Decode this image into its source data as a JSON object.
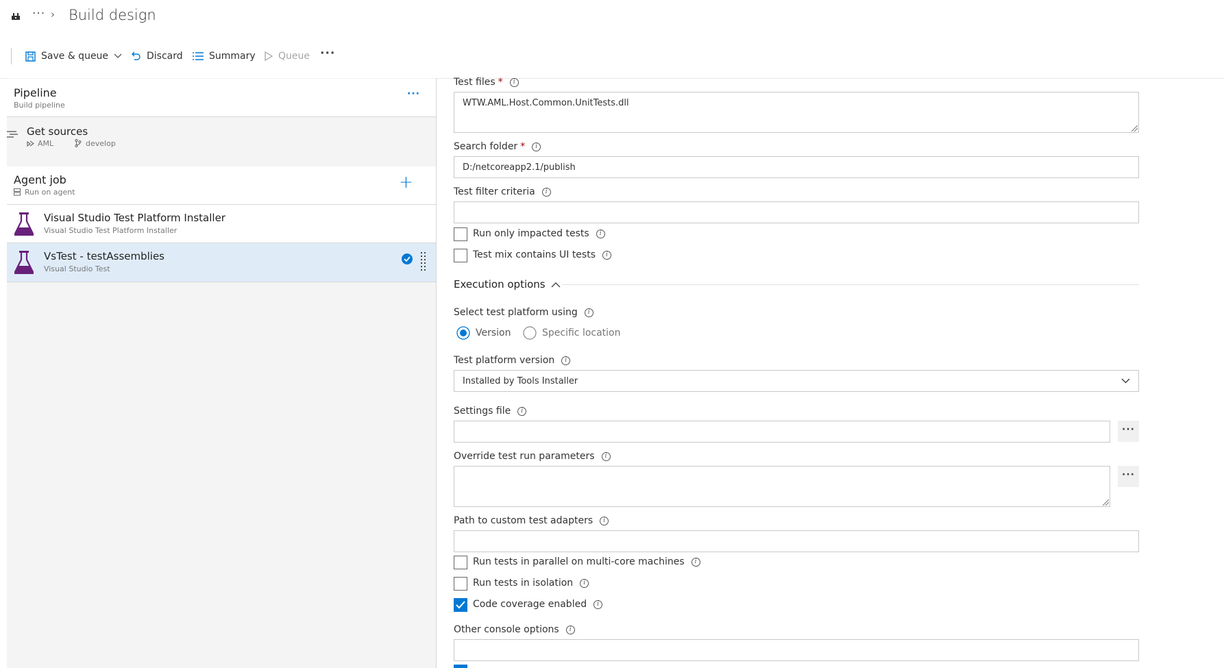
{
  "header": {
    "title": "Build design",
    "breadcrumb_more": "···",
    "breadcrumb_chevron": "›"
  },
  "toolbar": {
    "save_queue": "Save & queue",
    "discard": "Discard",
    "summary": "Summary",
    "queue": "Queue",
    "more": "···"
  },
  "pipeline": {
    "title": "Pipeline",
    "subtitle": "Build pipeline",
    "more": "···",
    "get_sources": "Get sources",
    "repo": "AML",
    "branch": "develop",
    "agent_job": "Agent job",
    "agent_sub": "Run on agent",
    "add": "+",
    "tasks": [
      {
        "title": "Visual Studio Test Platform Installer",
        "subtitle": "Visual Studio Test Platform Installer"
      },
      {
        "title": "VsTest - testAssemblies",
        "subtitle": "Visual Studio Test"
      }
    ]
  },
  "form": {
    "test_files_label": "Test files",
    "test_files_value": "WTW.AML.Host.Common.UnitTests.dll",
    "search_folder_label": "Search folder",
    "search_folder_value": "D:/netcoreapp2.1/publish",
    "required_mark": "*",
    "test_filter_label": "Test filter criteria",
    "run_impacted_label": "Run only impacted tests",
    "ui_tests_label": "Test mix contains UI tests",
    "execution_options": "Execution options",
    "select_platform_label": "Select test platform using",
    "radio_version": "Version",
    "radio_specific": "Specific location",
    "platform_version_label": "Test platform version",
    "platform_version_value": "Installed by Tools Installer",
    "settings_file_label": "Settings file",
    "override_label": "Override test run parameters",
    "adapters_label": "Path to custom test adapters",
    "parallel_label": "Run tests in parallel on multi-core machines",
    "isolation_label": "Run tests in isolation",
    "coverage_label": "Code coverage enabled",
    "console_label": "Other console options",
    "browse": "···",
    "info": "i"
  }
}
